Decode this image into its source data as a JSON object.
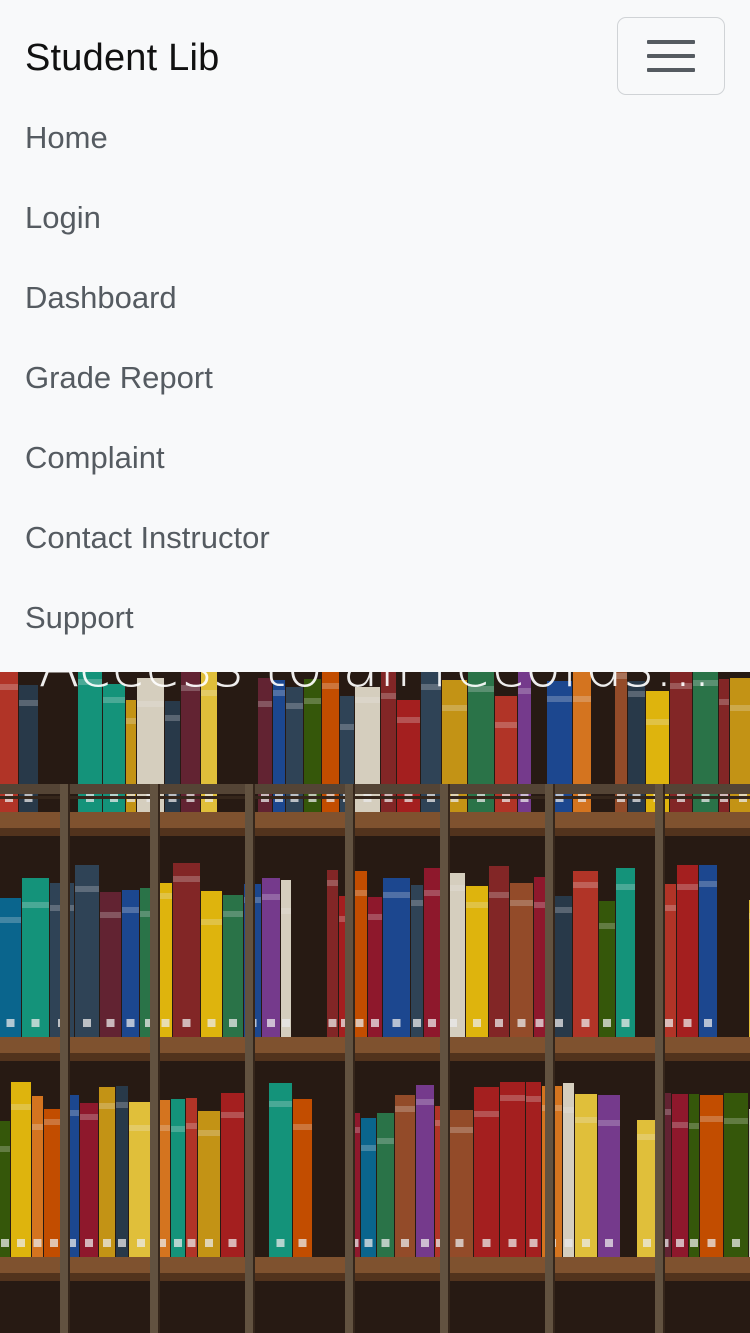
{
  "navbar": {
    "brand": "Student Lib",
    "toggler_icon": "hamburger-icon",
    "items": [
      {
        "label": "Home"
      },
      {
        "label": "Login"
      },
      {
        "label": "Dashboard"
      },
      {
        "label": "Grade Report"
      },
      {
        "label": "Complaint"
      },
      {
        "label": "Contact Instructor"
      },
      {
        "label": "Support"
      }
    ]
  },
  "hero": {
    "caption": "Access to all records...",
    "image": "library-bookshelf-photo"
  },
  "colors": {
    "navbar_bg": "#f8f9fa",
    "link_text": "#555b61",
    "brand_text": "#111111"
  }
}
